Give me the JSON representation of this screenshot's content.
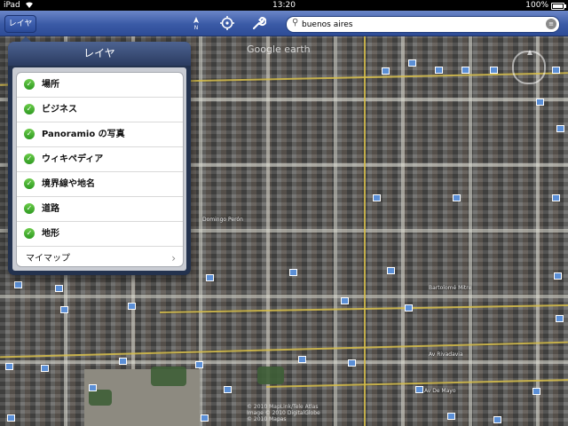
{
  "status_bar": {
    "carrier": "iPad",
    "time": "13:20",
    "battery_percent": "100%",
    "battery_level": 1.0
  },
  "toolbar": {
    "layers_button_label": "レイヤ",
    "compass_icon": "north-arrow-icon",
    "locate_icon": "crosshair-icon",
    "tools_icon": "wrench-icon",
    "search": {
      "value": "buenos aires",
      "search_icon": "magnifier-icon",
      "list_icon": "list-icon"
    }
  },
  "layers_popover": {
    "title": "レイヤ",
    "items": [
      {
        "label": "場所",
        "checked": true
      },
      {
        "label": "ビジネス",
        "checked": true
      },
      {
        "label": "Panoramio の写真",
        "checked": true
      },
      {
        "label": "ウィキペディア",
        "checked": true
      },
      {
        "label": "境界線や地名",
        "checked": true
      },
      {
        "label": "道路",
        "checked": true
      },
      {
        "label": "地形",
        "checked": true
      }
    ],
    "my_maps_label": "マイマップ"
  },
  "map": {
    "watermark": "Google earth",
    "credit_line1": "© 2010 MapLink/Tele Atlas",
    "credit_line2": "Image © 2010 DigitalGlobe",
    "credit_line3": "© 2010 Mapas",
    "street_labels": [
      "Av Rivadavia",
      "Av De Mayo",
      "Bartolomé Mitre",
      "Domingo Perón"
    ],
    "colors": {
      "road": "#d8c04a",
      "marker": "#5b8fd6"
    }
  }
}
